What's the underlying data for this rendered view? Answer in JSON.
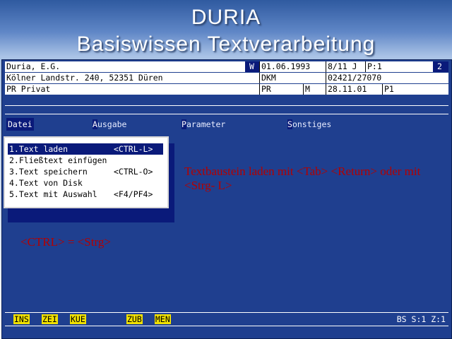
{
  "slide": {
    "title": "DURIA",
    "subtitle": "Basiswissen Textverarbeitung"
  },
  "header": {
    "row1": {
      "name": "Duria, E.G.",
      "flag": "W",
      "date": "01.06.1993",
      "code": "8/11 J",
      "page": "P:1",
      "num": "2"
    },
    "row2": {
      "address": "Kölner Landstr. 240, 52351 Düren",
      "abbr": "DKM",
      "phone": "02421/27070"
    },
    "row3": {
      "type": "PR Privat",
      "kind": "PR",
      "m": "M",
      "date2": "28.11.01",
      "p": "P1"
    }
  },
  "menubar": {
    "items": [
      {
        "label": "Datei",
        "active": true
      },
      {
        "key": "A",
        "rest": "usgabe"
      },
      {
        "key": "P",
        "rest": "arameter"
      },
      {
        "key": "S",
        "rest": "onstiges"
      }
    ]
  },
  "dropdown": {
    "items": [
      {
        "label": "1.Text laden",
        "shortcut": "<CTRL-L>"
      },
      {
        "label": "2.Fließtext einfügen",
        "shortcut": ""
      },
      {
        "label": "3.Text speichern",
        "shortcut": "<CTRL-O>"
      },
      {
        "label": "4.Text von Disk",
        "shortcut": ""
      },
      {
        "label": "5.Text mit Auswahl",
        "shortcut": "<F4/PF4>"
      }
    ]
  },
  "notes": {
    "hint": "Textbaustein laden mit <Tab> <Return> oder mit <Strg- L>",
    "ctrl": "<CTRL> = <Strg>"
  },
  "statusbar": {
    "keys": [
      "INS",
      "ZEI",
      "KUE",
      "ZUB",
      "MEN"
    ],
    "info": "BS S:1 Z:1"
  },
  "colors": {
    "screen": "#1f3f8f",
    "highlight": "#0a1a7a",
    "note": "#b30000",
    "key": "#f0e000"
  }
}
